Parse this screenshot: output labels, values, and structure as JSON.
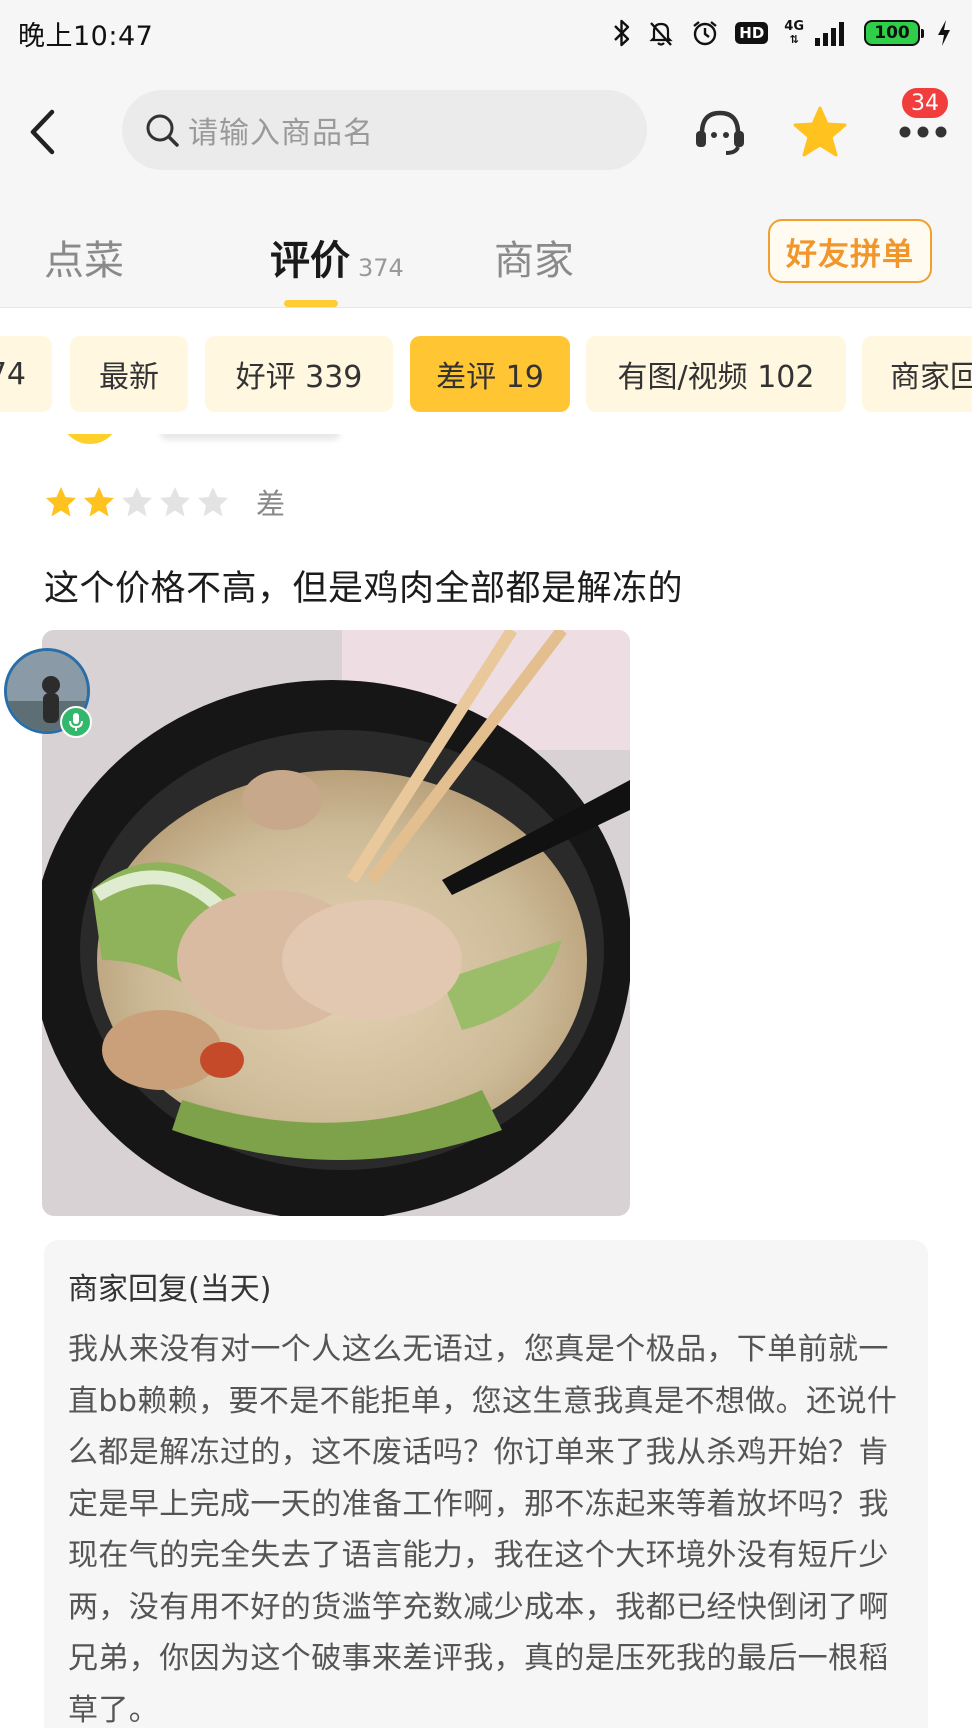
{
  "status_bar": {
    "time": "晚上10:47",
    "network": "4G",
    "hd_label": "HD",
    "battery": "100"
  },
  "top_nav": {
    "search_placeholder": "请输入商品名",
    "more_badge_count": "34",
    "icons": [
      "back-icon",
      "search-icon",
      "customer-service-icon",
      "star-favorite-icon",
      "more-icon"
    ]
  },
  "tabs": {
    "items": [
      {
        "label": "点菜",
        "count": ""
      },
      {
        "label": "评价",
        "count": "374"
      },
      {
        "label": "商家",
        "count": ""
      }
    ],
    "active_index": 1,
    "friend_order_label": "好友拼单"
  },
  "filters": {
    "chips": [
      {
        "label": "74"
      },
      {
        "label": "最新"
      },
      {
        "label": "好评 339"
      },
      {
        "label": "差评 19"
      },
      {
        "label": "有图/视频 102"
      },
      {
        "label": "商家回"
      }
    ],
    "active_index": 3
  },
  "review": {
    "rating": 2,
    "rating_max": 5,
    "rating_label": "差",
    "text": "这个价格不高，但是鸡肉全部都是解冻的",
    "merchant_reply": {
      "title": "商家回复(当天)",
      "body": "我从来没有对一个人这么无语过，您真是个极品，下单前就一直bb赖赖，要不是不能拒单，您这生意我真是不想做。还说什么都是解冻过的，这不废话吗？你订单来了我从杀鸡开始？肯定是早上完成一天的准备工作啊，那不冻起来等着放坏吗？我现在气的完全失去了语言能力，我在这个大环境外没有短斤少两，没有用不好的货滥竽充数减少成本，我都已经快倒闭了啊兄弟，你因为这个破事来差评我，真的是压死我的最后一根稻草了。"
    }
  },
  "colors": {
    "accent_yellow": "#ffc532",
    "chip_bg": "#fff7df",
    "friend_order_orange": "#f0962a",
    "badge_red": "#f23d3d"
  }
}
